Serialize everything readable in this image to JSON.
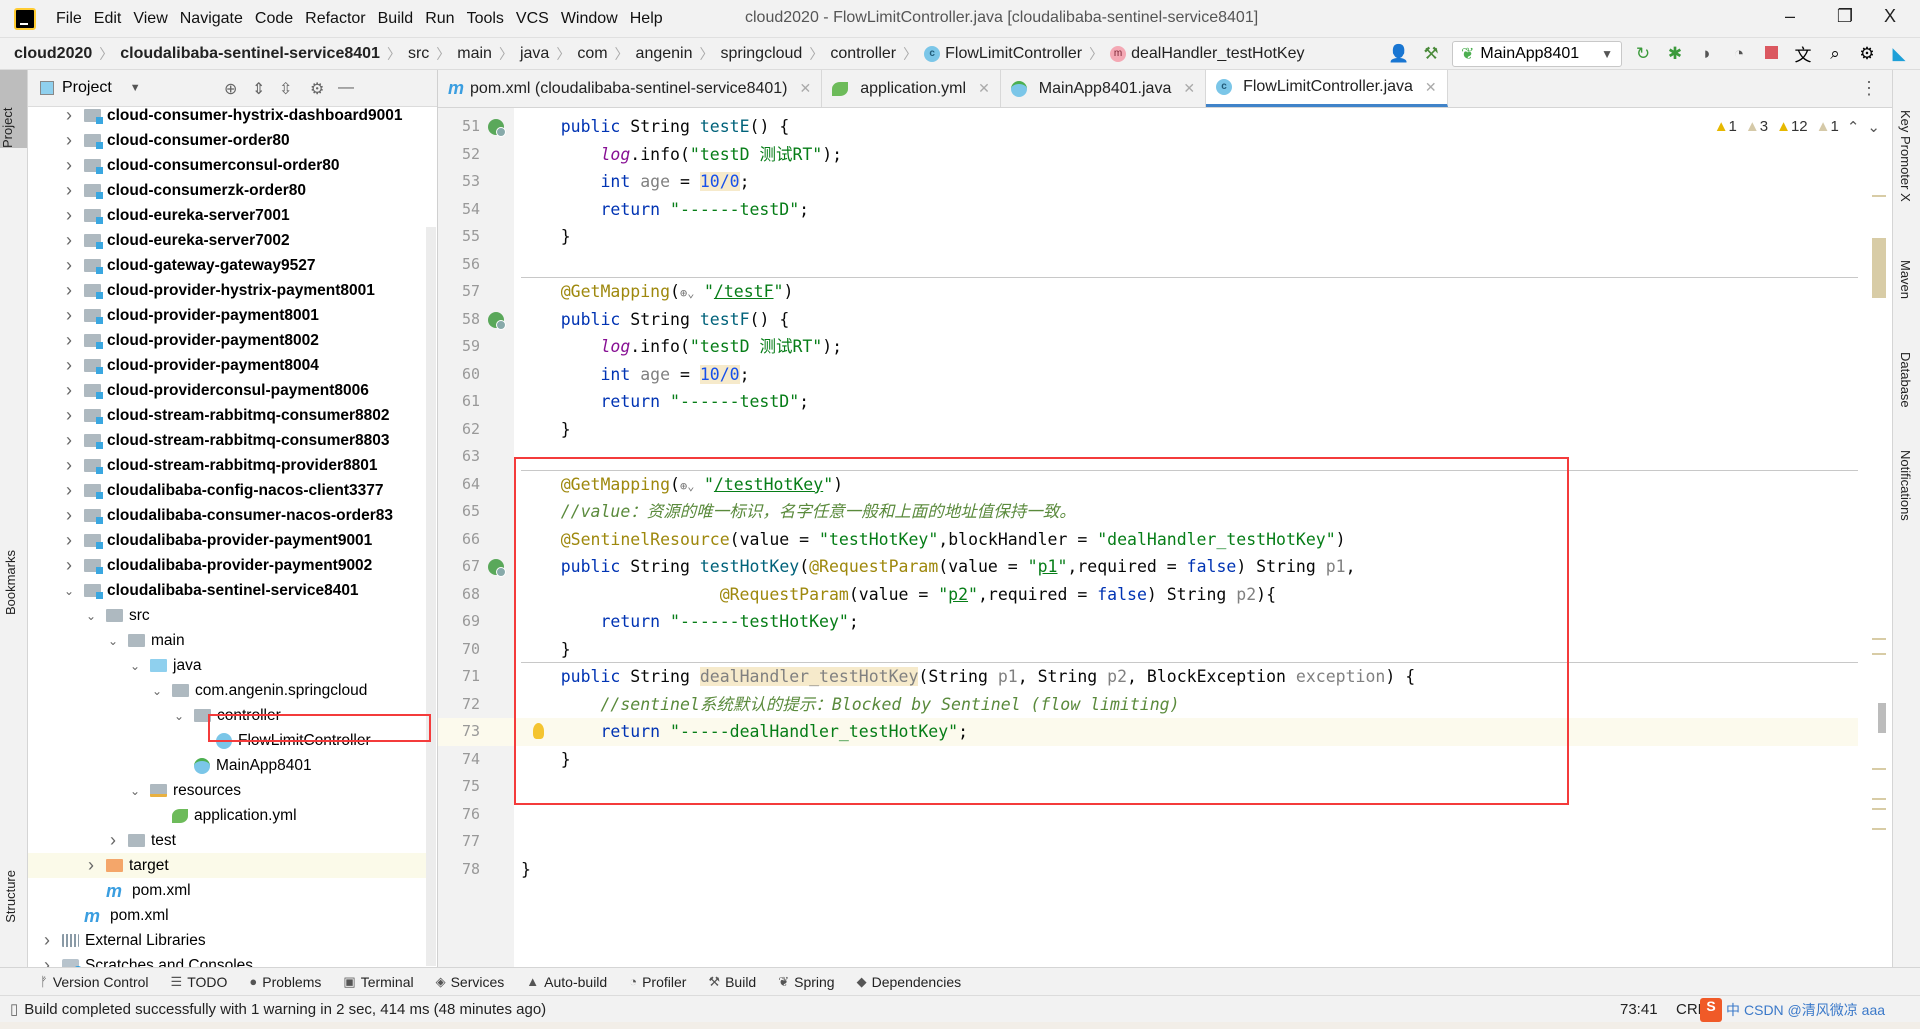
{
  "window": {
    "title": "cloud2020 - FlowLimitController.java [cloudalibaba-sentinel-service8401]",
    "minimize": "–",
    "restore": "❐",
    "close": "X"
  },
  "menu": [
    "File",
    "Edit",
    "View",
    "Navigate",
    "Code",
    "Refactor",
    "Build",
    "Run",
    "Tools",
    "VCS",
    "Window",
    "Help"
  ],
  "breadcrumb": [
    "cloud2020",
    "cloudalibaba-sentinel-service8401",
    "src",
    "main",
    "java",
    "com",
    "angenin",
    "springcloud",
    "controller",
    "FlowLimitController",
    "dealHandler_testHotKey"
  ],
  "toolbar": {
    "run_config": "MainApp8401",
    "icons": [
      "user-icon",
      "hammer-icon",
      "rerun-icon",
      "debug-icon",
      "coverage-icon",
      "profile-icon",
      "stop-icon",
      "translate-icon",
      "search-icon",
      "settings-icon",
      "toolbox-icon"
    ]
  },
  "left_strip": {
    "project": "Project",
    "bookmarks": "Bookmarks",
    "structure": "Structure"
  },
  "project_panel": {
    "title": "Project"
  },
  "tree": [
    {
      "label": "cloud-consumer-hystrix-dashboard9001",
      "depth": 1,
      "icon": "mod",
      "chev": ">",
      "bold": true
    },
    {
      "label": "cloud-consumer-order80",
      "depth": 1,
      "icon": "mod",
      "chev": ">",
      "bold": true
    },
    {
      "label": "cloud-consumerconsul-order80",
      "depth": 1,
      "icon": "mod",
      "chev": ">",
      "bold": true
    },
    {
      "label": "cloud-consumerzk-order80",
      "depth": 1,
      "icon": "mod",
      "chev": ">",
      "bold": true
    },
    {
      "label": "cloud-eureka-server7001",
      "depth": 1,
      "icon": "mod",
      "chev": ">",
      "bold": true
    },
    {
      "label": "cloud-eureka-server7002",
      "depth": 1,
      "icon": "mod",
      "chev": ">",
      "bold": true
    },
    {
      "label": "cloud-gateway-gateway9527",
      "depth": 1,
      "icon": "mod",
      "chev": ">",
      "bold": true
    },
    {
      "label": "cloud-provider-hystrix-payment8001",
      "depth": 1,
      "icon": "mod",
      "chev": ">",
      "bold": true
    },
    {
      "label": "cloud-provider-payment8001",
      "depth": 1,
      "icon": "mod",
      "chev": ">",
      "bold": true
    },
    {
      "label": "cloud-provider-payment8002",
      "depth": 1,
      "icon": "mod",
      "chev": ">",
      "bold": true
    },
    {
      "label": "cloud-provider-payment8004",
      "depth": 1,
      "icon": "mod",
      "chev": ">",
      "bold": true
    },
    {
      "label": "cloud-providerconsul-payment8006",
      "depth": 1,
      "icon": "mod",
      "chev": ">",
      "bold": true
    },
    {
      "label": "cloud-stream-rabbitmq-consumer8802",
      "depth": 1,
      "icon": "mod",
      "chev": ">",
      "bold": true
    },
    {
      "label": "cloud-stream-rabbitmq-consumer8803",
      "depth": 1,
      "icon": "mod",
      "chev": ">",
      "bold": true
    },
    {
      "label": "cloud-stream-rabbitmq-provider8801",
      "depth": 1,
      "icon": "mod",
      "chev": ">",
      "bold": true
    },
    {
      "label": "cloudalibaba-config-nacos-client3377",
      "depth": 1,
      "icon": "mod",
      "chev": ">",
      "bold": true
    },
    {
      "label": "cloudalibaba-consumer-nacos-order83",
      "depth": 1,
      "icon": "mod",
      "chev": ">",
      "bold": true
    },
    {
      "label": "cloudalibaba-provider-payment9001",
      "depth": 1,
      "icon": "mod",
      "chev": ">",
      "bold": true
    },
    {
      "label": "cloudalibaba-provider-payment9002",
      "depth": 1,
      "icon": "mod",
      "chev": ">",
      "bold": true
    },
    {
      "label": "cloudalibaba-sentinel-service8401",
      "depth": 1,
      "icon": "mod",
      "chev": "v",
      "bold": true
    },
    {
      "label": "src",
      "depth": 2,
      "icon": "folder",
      "chev": "v"
    },
    {
      "label": "main",
      "depth": 3,
      "icon": "folder",
      "chev": "v"
    },
    {
      "label": "java",
      "depth": 4,
      "icon": "src",
      "chev": "v"
    },
    {
      "label": "com.angenin.springcloud",
      "depth": 5,
      "icon": "pkg",
      "chev": "v"
    },
    {
      "label": "controller",
      "depth": 6,
      "icon": "pkg",
      "chev": "v"
    },
    {
      "label": "FlowLimitController",
      "depth": 7,
      "icon": "cls",
      "chev": ""
    },
    {
      "label": "MainApp8401",
      "depth": 6,
      "icon": "app",
      "chev": ""
    },
    {
      "label": "resources",
      "depth": 4,
      "icon": "res",
      "chev": "v"
    },
    {
      "label": "application.yml",
      "depth": 5,
      "icon": "yml",
      "chev": ""
    },
    {
      "label": "test",
      "depth": 3,
      "icon": "folder",
      "chev": ">"
    },
    {
      "label": "target",
      "depth": 2,
      "icon": "target",
      "chev": ">",
      "selected": true
    },
    {
      "label": "pom.xml",
      "depth": 2,
      "icon": "pom",
      "chev": ""
    },
    {
      "label": "pom.xml",
      "depth": 1,
      "icon": "pom",
      "chev": ""
    },
    {
      "label": "External Libraries",
      "depth": 0,
      "icon": "lib",
      "chev": ">"
    },
    {
      "label": "Scratches and Consoles",
      "depth": 0,
      "icon": "scr",
      "chev": ">"
    }
  ],
  "tabs": [
    {
      "label": "pom.xml (cloudalibaba-sentinel-service8401)",
      "icon": "m"
    },
    {
      "label": "application.yml",
      "icon": "yml"
    },
    {
      "label": "MainApp8401.java",
      "icon": "app"
    },
    {
      "label": "FlowLimitController.java",
      "icon": "c",
      "active": true
    }
  ],
  "inspections": [
    {
      "sev": "w1",
      "count": "1"
    },
    {
      "sev": "w2",
      "count": "3"
    },
    {
      "sev": "w1",
      "count": "12"
    },
    {
      "sev": "w2",
      "count": "1"
    }
  ],
  "code": [
    {
      "n": "51",
      "run": true,
      "t": [
        [
          "t",
          "    "
        ],
        [
          "k",
          "public "
        ],
        [
          "t",
          "String "
        ],
        [
          "m",
          "testE"
        ],
        [
          "t",
          "() {"
        ]
      ]
    },
    {
      "n": "52",
      "t": [
        [
          "t",
          "        "
        ],
        [
          "f",
          "log"
        ],
        [
          "t",
          ".info("
        ],
        [
          "s",
          "\"testD 测试RT\""
        ],
        [
          "t",
          ");"
        ]
      ]
    },
    {
      "n": "53",
      "t": [
        [
          "t",
          "        "
        ],
        [
          "k",
          "int "
        ],
        [
          "g",
          "age"
        ],
        [
          "t",
          " = "
        ],
        [
          "n",
          "10/0"
        ],
        [
          "t",
          ";"
        ]
      ]
    },
    {
      "n": "54",
      "t": [
        [
          "t",
          "        "
        ],
        [
          "k",
          "return "
        ],
        [
          "s",
          "\"------testD\""
        ],
        [
          "t",
          ";"
        ]
      ]
    },
    {
      "n": "55",
      "t": [
        [
          "t",
          "    }"
        ]
      ]
    },
    {
      "n": "56",
      "t": []
    },
    {
      "n": "57",
      "sep": true,
      "t": [
        [
          "t",
          "    "
        ],
        [
          "a",
          "@GetMapping"
        ],
        [
          "t",
          "("
        ],
        [
          "i",
          "⊕v"
        ],
        [
          "s",
          "\""
        ],
        [
          "u",
          "/testF"
        ],
        [
          "s",
          "\""
        ],
        [
          "t",
          ")"
        ]
      ]
    },
    {
      "n": "58",
      "run": true,
      "t": [
        [
          "t",
          "    "
        ],
        [
          "k",
          "public "
        ],
        [
          "t",
          "String "
        ],
        [
          "m",
          "testF"
        ],
        [
          "t",
          "() {"
        ]
      ]
    },
    {
      "n": "59",
      "t": [
        [
          "t",
          "        "
        ],
        [
          "f",
          "log"
        ],
        [
          "t",
          ".info("
        ],
        [
          "s",
          "\"testD 测试RT\""
        ],
        [
          "t",
          ");"
        ]
      ]
    },
    {
      "n": "60",
      "t": [
        [
          "t",
          "        "
        ],
        [
          "k",
          "int "
        ],
        [
          "g",
          "age"
        ],
        [
          "t",
          " = "
        ],
        [
          "n",
          "10/0"
        ],
        [
          "t",
          ";"
        ]
      ]
    },
    {
      "n": "61",
      "t": [
        [
          "t",
          "        "
        ],
        [
          "k",
          "return "
        ],
        [
          "s",
          "\"------testD\""
        ],
        [
          "t",
          ";"
        ]
      ]
    },
    {
      "n": "62",
      "t": [
        [
          "t",
          "    }"
        ]
      ]
    },
    {
      "n": "63",
      "t": []
    },
    {
      "n": "64",
      "sep": true,
      "t": [
        [
          "t",
          "    "
        ],
        [
          "a",
          "@GetMapping"
        ],
        [
          "t",
          "("
        ],
        [
          "i",
          "⊕v"
        ],
        [
          "s",
          "\""
        ],
        [
          "u",
          "/testHotKey"
        ],
        [
          "s",
          "\""
        ],
        [
          "t",
          ")"
        ]
      ]
    },
    {
      "n": "65",
      "t": [
        [
          "t",
          "    "
        ],
        [
          "c",
          "//value：资源的唯一标识，名字任意一般和上面的地址值保持一致。"
        ]
      ]
    },
    {
      "n": "66",
      "t": [
        [
          "t",
          "    "
        ],
        [
          "a",
          "@SentinelResource"
        ],
        [
          "t",
          "(value = "
        ],
        [
          "s",
          "\"testHotKey\""
        ],
        [
          "t",
          ",blockHandler = "
        ],
        [
          "s",
          "\"dealHandler_testHotKey\""
        ],
        [
          "t",
          ")"
        ]
      ]
    },
    {
      "n": "67",
      "run": true,
      "t": [
        [
          "t",
          "    "
        ],
        [
          "k",
          "public "
        ],
        [
          "t",
          "String "
        ],
        [
          "m",
          "testHotKey"
        ],
        [
          "t",
          "("
        ],
        [
          "a",
          "@RequestParam"
        ],
        [
          "t",
          "(value = "
        ],
        [
          "s",
          "\""
        ],
        [
          "u",
          "p1"
        ],
        [
          "s",
          "\""
        ],
        [
          "t",
          ",required = "
        ],
        [
          "k",
          "false"
        ],
        [
          "t",
          ") String "
        ],
        [
          "g",
          "p1"
        ],
        [
          "t",
          ","
        ]
      ]
    },
    {
      "n": "68",
      "t": [
        [
          "t",
          "                    "
        ],
        [
          "a",
          "@RequestParam"
        ],
        [
          "t",
          "(value = "
        ],
        [
          "s",
          "\""
        ],
        [
          "u",
          "p2"
        ],
        [
          "s",
          "\""
        ],
        [
          "t",
          ",required = "
        ],
        [
          "k",
          "false"
        ],
        [
          "t",
          ") String "
        ],
        [
          "g",
          "p2"
        ],
        [
          "t",
          "){"
        ]
      ]
    },
    {
      "n": "69",
      "t": [
        [
          "t",
          "        "
        ],
        [
          "k",
          "return "
        ],
        [
          "s",
          "\"------testHotKey\""
        ],
        [
          "t",
          ";"
        ]
      ]
    },
    {
      "n": "70",
      "t": [
        [
          "t",
          "    }"
        ]
      ]
    },
    {
      "n": "71",
      "sep": true,
      "t": [
        [
          "t",
          "    "
        ],
        [
          "k",
          "public "
        ],
        [
          "t",
          "String "
        ],
        [
          "h",
          "dealHandler_testHotKey"
        ],
        [
          "t",
          "(String "
        ],
        [
          "g",
          "p1"
        ],
        [
          "t",
          ", String "
        ],
        [
          "g",
          "p2"
        ],
        [
          "t",
          ", BlockException "
        ],
        [
          "g",
          "exception"
        ],
        [
          "t",
          ") {"
        ]
      ]
    },
    {
      "n": "72",
      "t": [
        [
          "t",
          "        "
        ],
        [
          "c",
          "//sentinel系统默认的提示：Blocked by Sentinel (flow limiting)"
        ]
      ]
    },
    {
      "n": "73",
      "cur": true,
      "bulb": true,
      "t": [
        [
          "t",
          "        "
        ],
        [
          "k",
          "return "
        ],
        [
          "s",
          "\"-----dealHandler_testHotKey\""
        ],
        [
          "t",
          ";"
        ]
      ]
    },
    {
      "n": "74",
      "t": [
        [
          "t",
          "    }"
        ]
      ]
    },
    {
      "n": "75",
      "t": []
    },
    {
      "n": "76",
      "t": []
    },
    {
      "n": "77",
      "t": []
    },
    {
      "n": "78",
      "t": [
        [
          "t",
          "}"
        ]
      ]
    }
  ],
  "right_strip": [
    "Key Promoter X",
    "Maven",
    "Database",
    "Notifications"
  ],
  "tool_windows": [
    {
      "label": "Version Control",
      "icon": "ᚠ"
    },
    {
      "label": "TODO",
      "icon": "☰"
    },
    {
      "label": "Problems",
      "icon": "●"
    },
    {
      "label": "Terminal",
      "icon": "▣"
    },
    {
      "label": "Services",
      "icon": "◈"
    },
    {
      "label": "Auto-build",
      "icon": "▲"
    },
    {
      "label": "Profiler",
      "icon": "◔"
    },
    {
      "label": "Build",
      "icon": "⚒"
    },
    {
      "label": "Spring",
      "icon": "❦"
    },
    {
      "label": "Dependencies",
      "icon": "◆"
    }
  ],
  "status": {
    "message": "Build completed successfully with 1 warning in 2 sec, 414 ms (48 minutes ago)",
    "position": "73:41",
    "line_sep": "CRLF",
    "watermark": "CSDN @清风微凉 aaa",
    "ime": "中"
  }
}
